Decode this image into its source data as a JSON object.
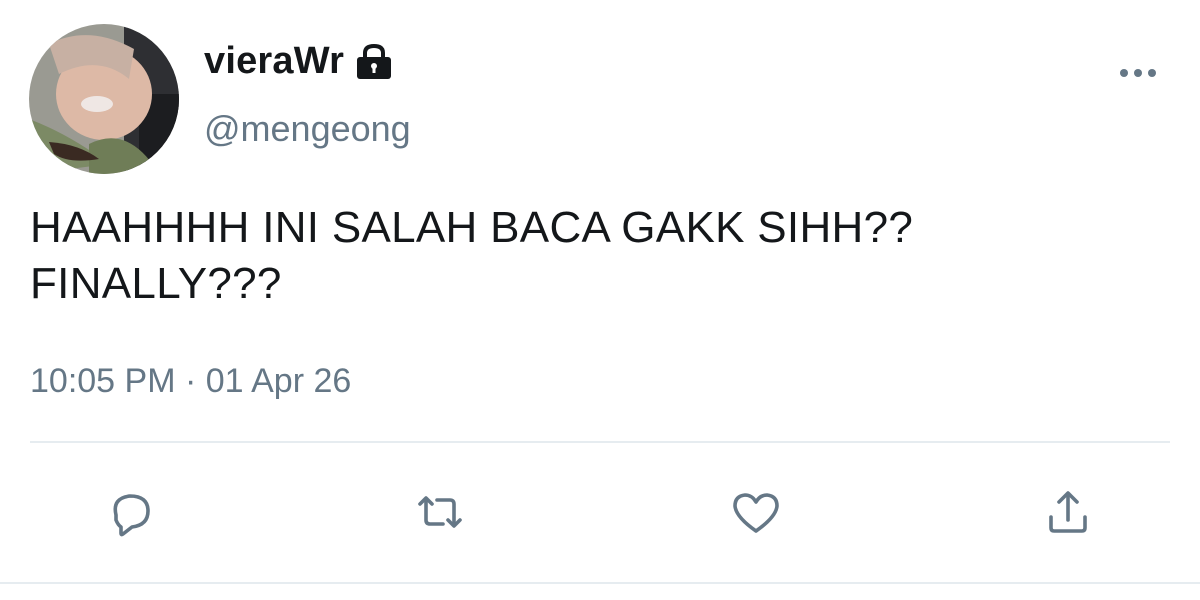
{
  "tweet": {
    "display_name": "vieraWr",
    "handle": "@mengeong",
    "text": "HAAHHHH INI SALAH BACA GAKK SIHH??\nFINALLY???",
    "timestamp": "10:05 PM · 01 Apr 26"
  },
  "icons": {
    "avatar": "profile-photo",
    "protected": "lock-icon",
    "more": "more-horizontal-icon",
    "reply": "reply-icon",
    "retweet": "retweet-icon",
    "like": "heart-icon",
    "share": "share-icon"
  },
  "colors": {
    "text_primary": "#14171a",
    "text_secondary": "#657786",
    "icon": "#657786",
    "divider": "#e6ecf0"
  }
}
